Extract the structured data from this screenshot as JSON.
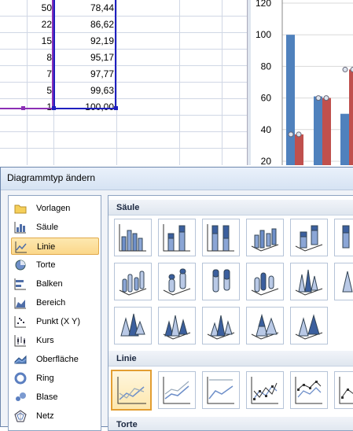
{
  "sheet": {
    "rows": [
      {
        "a": "50",
        "b": "78,44"
      },
      {
        "a": "22",
        "b": "86,62"
      },
      {
        "a": "15",
        "b": "92,19"
      },
      {
        "a": "8",
        "b": "95,17"
      },
      {
        "a": "7",
        "b": "97,77"
      },
      {
        "a": "5",
        "b": "99,63"
      },
      {
        "a": "1",
        "b": "100,00"
      }
    ]
  },
  "chart_data": {
    "type": "bar",
    "title": "",
    "xlabel": "",
    "ylabel": "",
    "ylim": [
      20,
      120
    ],
    "y_ticks": [
      "120",
      "100",
      "80",
      "60",
      "40",
      "20"
    ],
    "series": [
      {
        "color": "#4f81bd",
        "values": [
          100,
          61,
          50
        ]
      },
      {
        "color": "#c0504d",
        "values": [
          37,
          60,
          78
        ]
      }
    ],
    "point_markers": [
      37,
      60,
      78
    ]
  },
  "dialog": {
    "title": "Diagrammtyp ändern",
    "categories": [
      {
        "label": "Vorlagen",
        "icon": "folder-icon"
      },
      {
        "label": "Säule",
        "icon": "column-chart-icon"
      },
      {
        "label": "Linie",
        "icon": "line-chart-icon",
        "selected": true
      },
      {
        "label": "Torte",
        "icon": "pie-chart-icon"
      },
      {
        "label": "Balken",
        "icon": "bar-chart-icon"
      },
      {
        "label": "Bereich",
        "icon": "area-chart-icon"
      },
      {
        "label": "Punkt (X Y)",
        "icon": "scatter-chart-icon"
      },
      {
        "label": "Kurs",
        "icon": "stock-chart-icon"
      },
      {
        "label": "Oberfläche",
        "icon": "surface-chart-icon"
      },
      {
        "label": "Ring",
        "icon": "doughnut-chart-icon"
      },
      {
        "label": "Blase",
        "icon": "bubble-chart-icon"
      },
      {
        "label": "Netz",
        "icon": "radar-chart-icon"
      }
    ],
    "sections": {
      "saeule": "Säule",
      "linie": "Linie",
      "torte": "Torte"
    }
  },
  "colors": {
    "accent_selected": "#fbd78a",
    "series_blue": "#4f81bd",
    "series_red": "#c0504d"
  }
}
